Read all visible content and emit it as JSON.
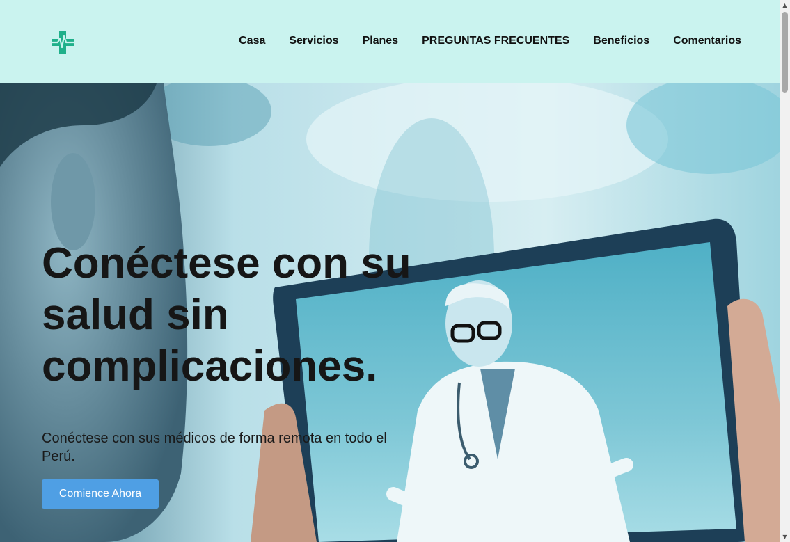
{
  "header": {
    "logo_icon": "medical-cross-heartbeat-icon",
    "nav": [
      {
        "label": "Casa"
      },
      {
        "label": "Servicios"
      },
      {
        "label": "Planes"
      },
      {
        "label": "PREGUNTAS FRECUENTES"
      },
      {
        "label": "Beneficios"
      },
      {
        "label": "Comentarios"
      }
    ]
  },
  "hero": {
    "title": "Conéctese con su salud sin complicaciones.",
    "subtitle": "Conéctese con sus médicos de forma remota en todo el Perú.",
    "cta_label": "Comience Ahora"
  },
  "colors": {
    "navbar_bg": "#caf3ef",
    "cta_bg": "#4f9fe4",
    "logo_green": "#1fb08a"
  }
}
